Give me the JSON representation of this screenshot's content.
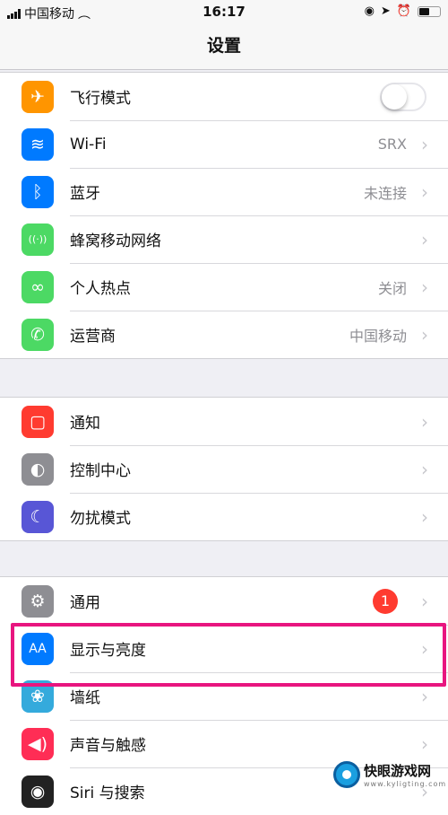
{
  "status": {
    "carrier": "中国移动",
    "time": "16:17",
    "battery_percent": 50
  },
  "nav": {
    "title": "设置"
  },
  "groups": [
    [
      {
        "label": "飞行模式",
        "icon": "airplane-icon",
        "color": "#ff9500",
        "toggle": false
      },
      {
        "label": "Wi-Fi",
        "icon": "wifi-icon",
        "color": "#007aff",
        "value": "SRX"
      },
      {
        "label": "蓝牙",
        "icon": "bluetooth-icon",
        "color": "#007aff",
        "value": "未连接"
      },
      {
        "label": "蜂窝移动网络",
        "icon": "cellular-icon",
        "color": "#4cd964",
        "value": ""
      },
      {
        "label": "个人热点",
        "icon": "hotspot-icon",
        "color": "#4cd964",
        "value": "关闭"
      },
      {
        "label": "运营商",
        "icon": "phone-icon",
        "color": "#4cd964",
        "value": "中国移动"
      }
    ],
    [
      {
        "label": "通知",
        "icon": "notifications-icon",
        "color": "#ff3b30",
        "value": ""
      },
      {
        "label": "控制中心",
        "icon": "control-center-icon",
        "color": "#8e8e93",
        "value": ""
      },
      {
        "label": "勿扰模式",
        "icon": "moon-icon",
        "color": "#5856d6",
        "value": ""
      }
    ],
    [
      {
        "label": "通用",
        "icon": "gear-icon",
        "color": "#8e8e93",
        "badge": "1"
      },
      {
        "label": "显示与亮度",
        "icon": "display-icon",
        "color": "#007aff",
        "value": "",
        "highlighted": true
      },
      {
        "label": "墙纸",
        "icon": "wallpaper-icon",
        "color": "#34aadc",
        "value": ""
      },
      {
        "label": "声音与触感",
        "icon": "sound-icon",
        "color": "#ff2d55",
        "value": ""
      },
      {
        "label": "Siri 与搜索",
        "icon": "siri-icon",
        "color": "#222",
        "value": ""
      }
    ]
  ],
  "watermark": {
    "name": "快眼游戏网",
    "url": "www.kyligting.com"
  }
}
